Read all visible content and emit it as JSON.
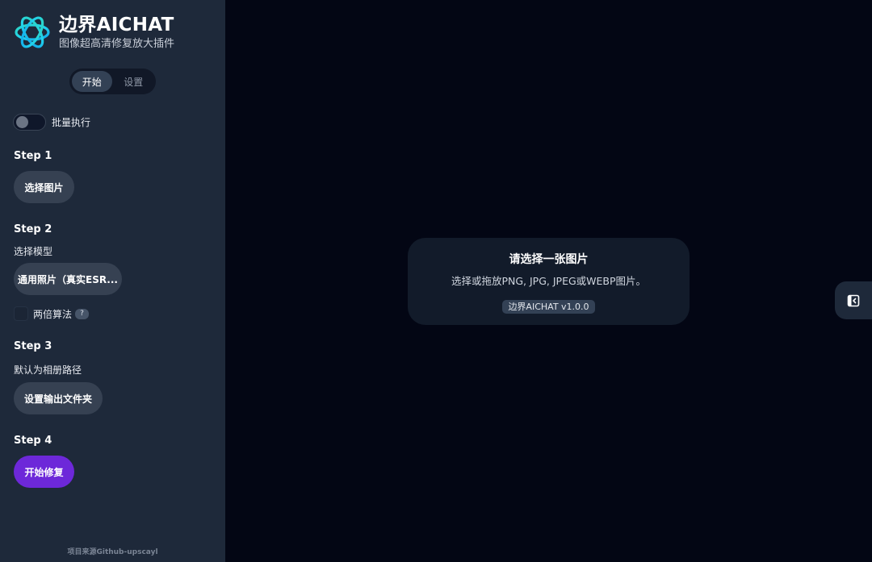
{
  "brand": {
    "title": "边界AICHAT",
    "subtitle": "图像超高清修复放大插件",
    "logo_icon": "swirl-logo-icon",
    "logo_colors": [
      "#22d3ee",
      "#2dd4bf",
      "#0ea5e9"
    ]
  },
  "tabs": [
    {
      "label": "开始",
      "active": true
    },
    {
      "label": "设置",
      "active": false
    }
  ],
  "batch": {
    "label": "批量执行",
    "enabled": false
  },
  "steps": {
    "step1": {
      "title": "Step 1",
      "button": "选择图片"
    },
    "step2": {
      "title": "Step 2",
      "desc": "选择模型",
      "button": "通用照片（真实ESR...",
      "checkbox_label": "两倍算法",
      "checkbox_checked": false,
      "help": "?"
    },
    "step3": {
      "title": "Step 3",
      "desc": "默认为相册路径",
      "button": "设置输出文件夹"
    },
    "step4": {
      "title": "Step 4",
      "button": "开始修复"
    }
  },
  "footer": {
    "text": "项目来源Github-upscayl"
  },
  "main": {
    "card": {
      "title": "请选择一张图片",
      "desc": "选择或拖放PNG, JPG, JPEG或WEBP图片。",
      "badge": "边界AICHAT v1.0.0"
    },
    "side_toggle_icon": "collapse-panel-icon"
  },
  "colors": {
    "sidebar_bg": "#1e293a",
    "main_bg": "#030614",
    "accent": "#6d28d9",
    "card_bg": "#121b2a"
  }
}
